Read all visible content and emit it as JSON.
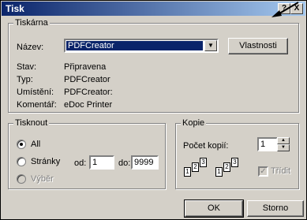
{
  "window": {
    "title": "Tisk",
    "help_label": "?",
    "close_label": "X"
  },
  "printer_group": {
    "legend": "Tiskárna",
    "name_label": "Název:",
    "name_value": "PDFCreator",
    "properties_button": "Vlastnosti",
    "rows": [
      {
        "label": "Stav:",
        "value": "Připravena"
      },
      {
        "label": "Typ:",
        "value": "PDFCreator"
      },
      {
        "label": "Umístění:",
        "value": "PDFCreator:"
      },
      {
        "label": "Komentář:",
        "value": "eDoc Printer"
      }
    ]
  },
  "print_range": {
    "legend": "Tisknout",
    "all_label": "All",
    "pages_label": "Stránky",
    "from_label": "od:",
    "from_value": "1",
    "to_label": "do:",
    "to_value": "9999",
    "selection_label": "Výběr",
    "selected": "All"
  },
  "copies": {
    "legend": "Kopie",
    "count_label": "Počet kopií:",
    "count_value": "1",
    "collate_label": "Třídit",
    "collate_checked": true,
    "collate_enabled": false,
    "collate_icon": [
      "1",
      "2",
      "3",
      "1",
      "2",
      "3"
    ]
  },
  "footer": {
    "ok_label": "OK",
    "cancel_label": "Storno"
  },
  "icons": {
    "dropdown": "chevron-down-icon",
    "spin_up": "spin-up-icon",
    "spin_down": "spin-down-icon"
  }
}
